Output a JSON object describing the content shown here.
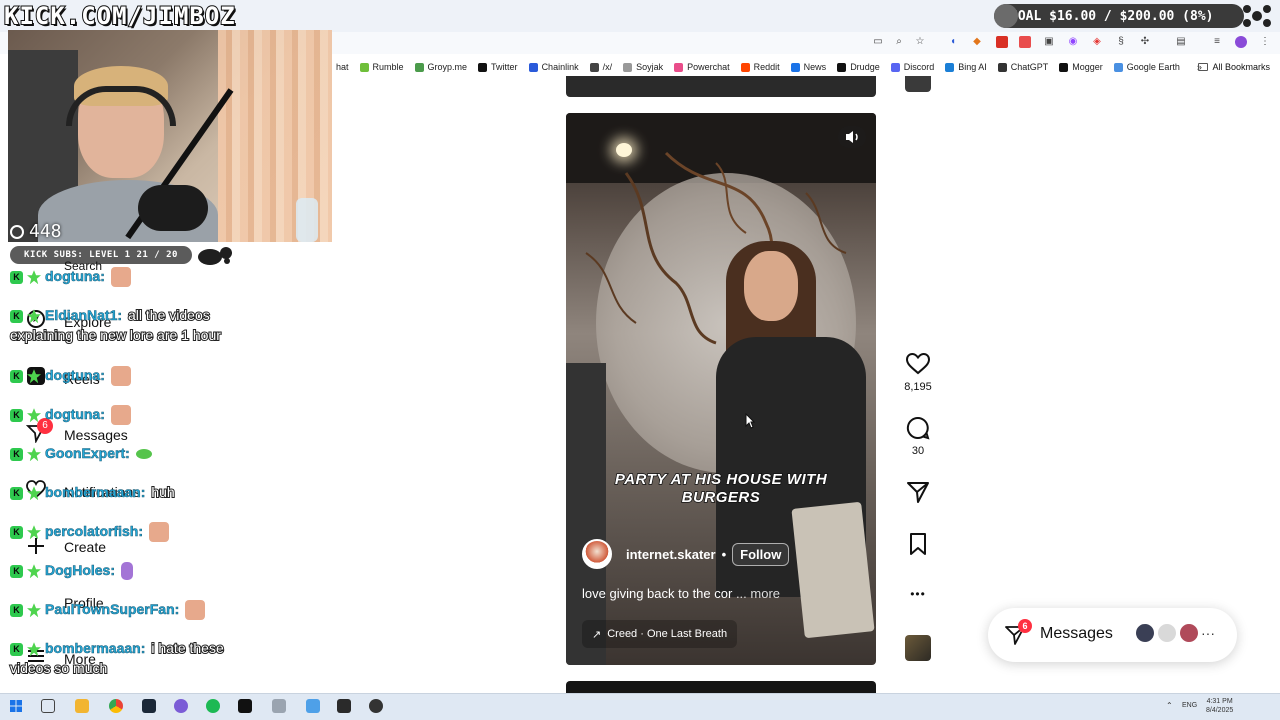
{
  "overlay": {
    "stream_title": "KICK.COM/JIMBOZ",
    "goal_text": "GOAL $16.00 / $200.00 (8%)",
    "viewer_count": "448",
    "kick_subs": "KICK SUBS: LEVEL 1 21 / 20"
  },
  "bookmarks": [
    {
      "label": "hat",
      "color": "#ffffff"
    },
    {
      "label": "Rumble",
      "color": "#6fbf3a"
    },
    {
      "label": "Groyp.me",
      "color": "#4b9b4b"
    },
    {
      "label": "Twitter",
      "color": "#111111"
    },
    {
      "label": "Chainlink",
      "color": "#2a5ada"
    },
    {
      "label": "/x/",
      "color": "#444444"
    },
    {
      "label": "Soyjak",
      "color": "#999999"
    },
    {
      "label": "Powerchat",
      "color": "#e94d8a"
    },
    {
      "label": "Reddit",
      "color": "#ff4500"
    },
    {
      "label": "News",
      "color": "#1a73e8"
    },
    {
      "label": "Drudge",
      "color": "#111111"
    },
    {
      "label": "Discord",
      "color": "#5865f2"
    },
    {
      "label": "Bing AI",
      "color": "#1b7fd6"
    },
    {
      "label": "ChatGPT",
      "color": "#333333"
    },
    {
      "label": "Mogger",
      "color": "#111111"
    },
    {
      "label": "Google Earth",
      "color": "#4a90e2"
    }
  ],
  "bookmarks_more": "»",
  "all_bookmarks": "All Bookmarks",
  "nav": {
    "search": "Search",
    "explore": "Explore",
    "reels": "Reels",
    "messages": "Messages",
    "messages_badge": "6",
    "notifications": "Notifications",
    "create": "Create",
    "profile": "Profile",
    "more": "More"
  },
  "chat": [
    {
      "user": "dogtuna:",
      "msg": ""
    },
    {
      "user": "EldianNat1:",
      "msg": "all the videos"
    },
    {
      "wrap": "explaining the new lore are 1 hour"
    },
    {
      "user": "dogtuna:",
      "msg": ""
    },
    {
      "user": "dogtuna:",
      "msg": ""
    },
    {
      "user": "GoonExpert:",
      "msg": ""
    },
    {
      "user": "bombermaaan:",
      "msg": "huh"
    },
    {
      "user": "percolatorfish:",
      "msg": ""
    },
    {
      "user": "DogHoles:",
      "msg": ""
    },
    {
      "user": "PaulTownSuperFan:",
      "msg": ""
    },
    {
      "user": "bombermaaan:",
      "msg": "i hate these"
    },
    {
      "wrap": "videos so much"
    }
  ],
  "post": {
    "caption_line1": "PARTY AT HIS HOUSE WITH",
    "caption_line2": "BURGERS",
    "author": "internet.skater",
    "separator": "•",
    "follow": "Follow",
    "description": "love giving back to the cor",
    "more": "... more",
    "audio": "Creed · One Last Breath",
    "likes": "8,195",
    "comments": "30",
    "more_actions": "•••"
  },
  "messages_pill": {
    "label": "Messages",
    "badge": "6",
    "overflow": "···"
  },
  "taskbar": {
    "lang": "ENG",
    "time": "4:31 PM",
    "date": "8/4/2025"
  }
}
